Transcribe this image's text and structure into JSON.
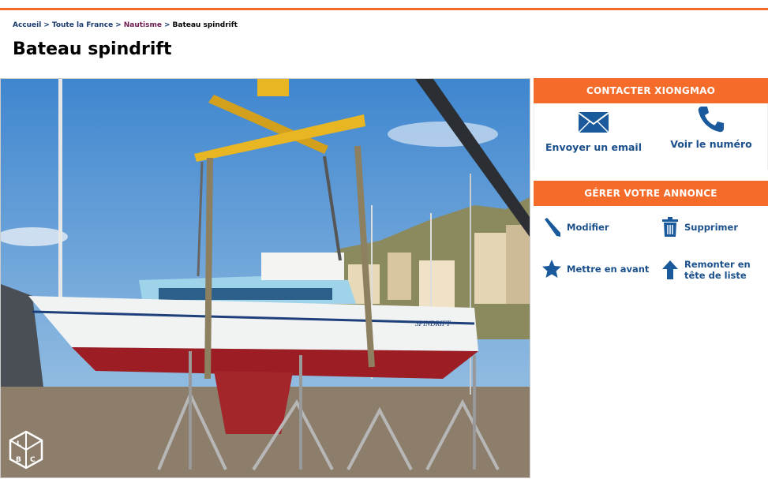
{
  "breadcrumb": {
    "home": "Accueil",
    "region": "Toute la France",
    "category": "Nautisme",
    "current": "Bateau spindrift",
    "separator": ">"
  },
  "page_title": "Bateau spindrift",
  "photo": {
    "boat_name_text": "SPINDRIFT",
    "badge_letters": [
      "L",
      "B",
      "C"
    ]
  },
  "contact": {
    "heading": "CONTACTER XIONGMAO",
    "email_label": "Envoyer un email",
    "phone_label": "Voir le numéro"
  },
  "manage": {
    "heading": "GÉRER VOTRE ANNONCE",
    "edit_label": "Modifier",
    "delete_label": "Supprimer",
    "feature_label": "Mettre en avant",
    "bump_label_line1": "Remonter en",
    "bump_label_line2": "tête de liste"
  },
  "colors": {
    "accent": "#f56b2a",
    "link": "#1a4f8b"
  }
}
